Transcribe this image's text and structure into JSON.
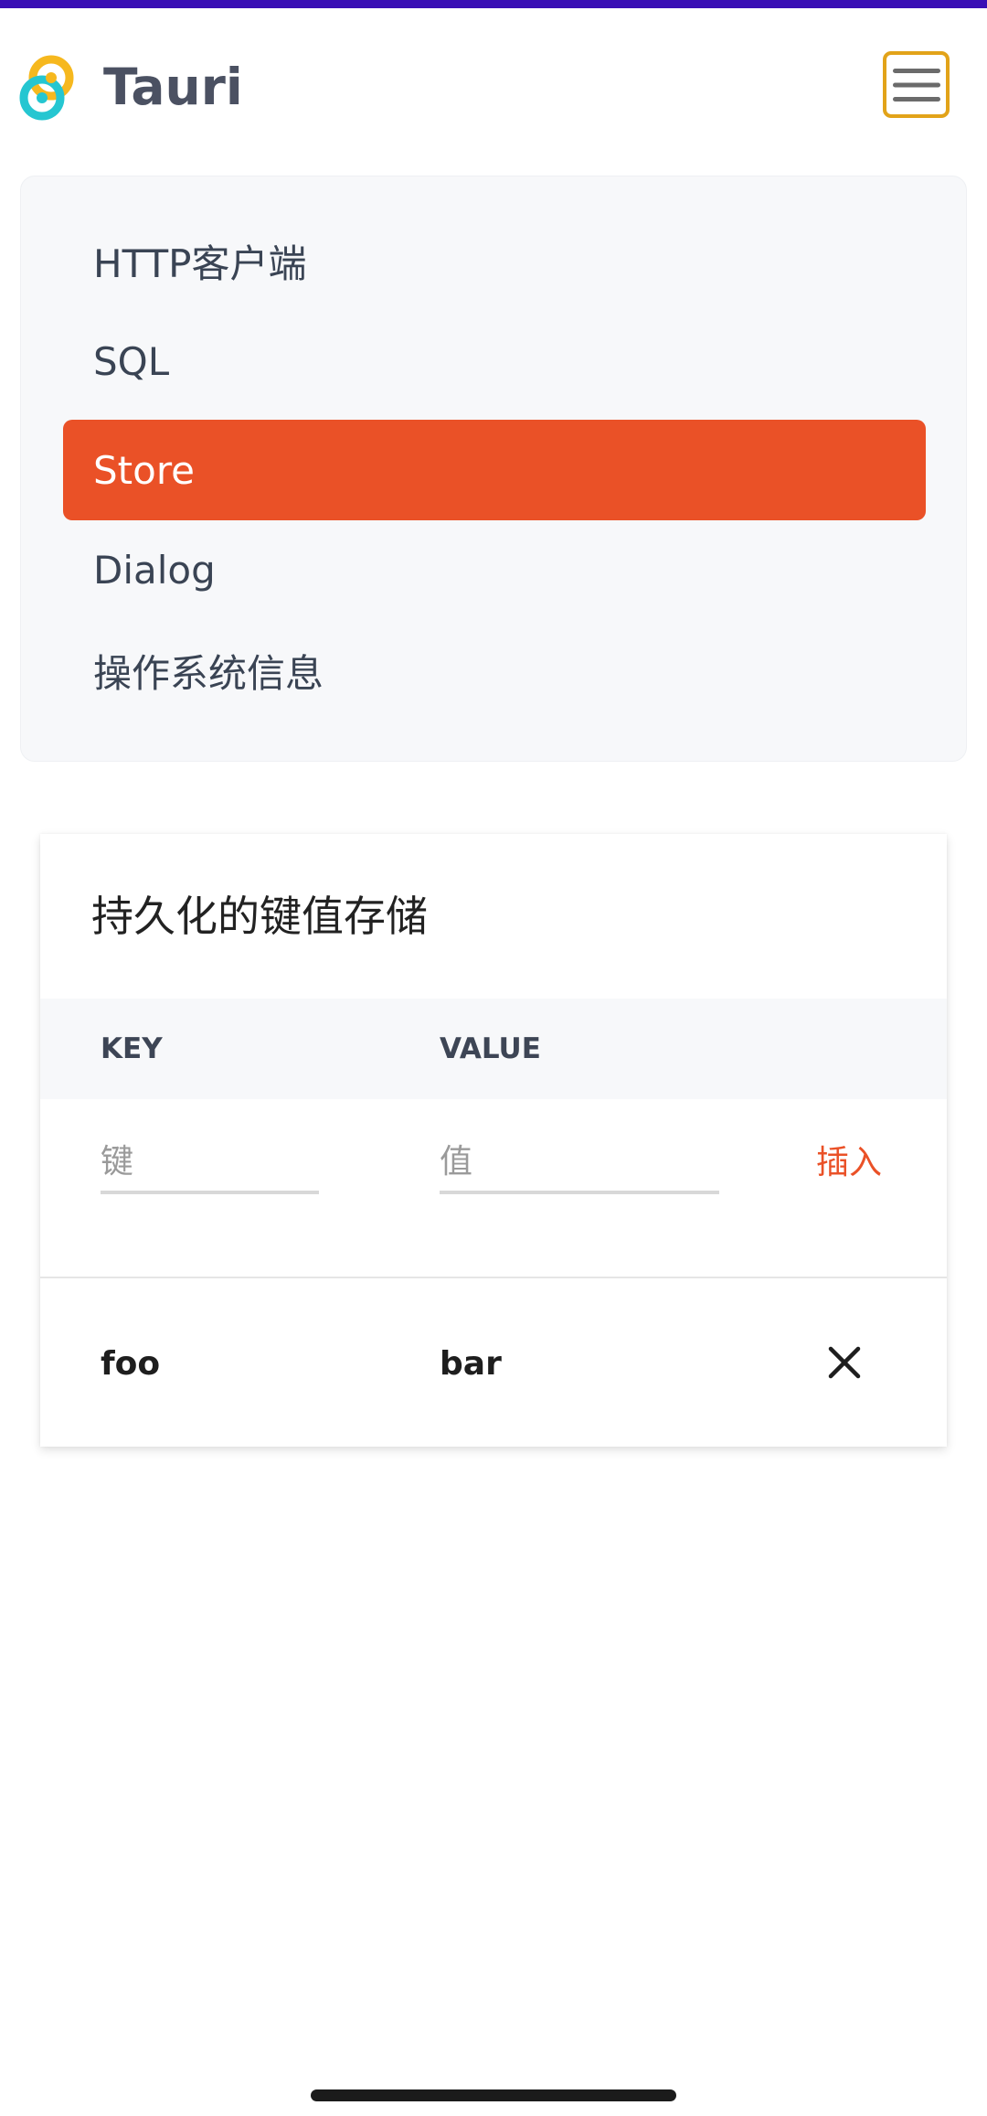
{
  "header": {
    "brand": "Tauri",
    "logo_icon": "tauri-logo-icon",
    "menu_icon": "hamburger-icon"
  },
  "nav": {
    "items": [
      {
        "label": "HTTP客户端",
        "active": false
      },
      {
        "label": "SQL",
        "active": false
      },
      {
        "label": "Store",
        "active": true
      },
      {
        "label": "Dialog",
        "active": false
      },
      {
        "label": "操作系统信息",
        "active": false
      }
    ]
  },
  "store": {
    "title": "持久化的键值存储",
    "columns": {
      "key": "KEY",
      "value": "VALUE"
    },
    "key_placeholder": "键",
    "value_placeholder": "值",
    "insert_label": "插入",
    "rows": [
      {
        "key": "foo",
        "value": "bar"
      }
    ],
    "delete_icon": "close-icon"
  },
  "colors": {
    "accent": "#ea5127",
    "menu_border": "#e2a319",
    "status_bar": "#3a0fb5"
  }
}
